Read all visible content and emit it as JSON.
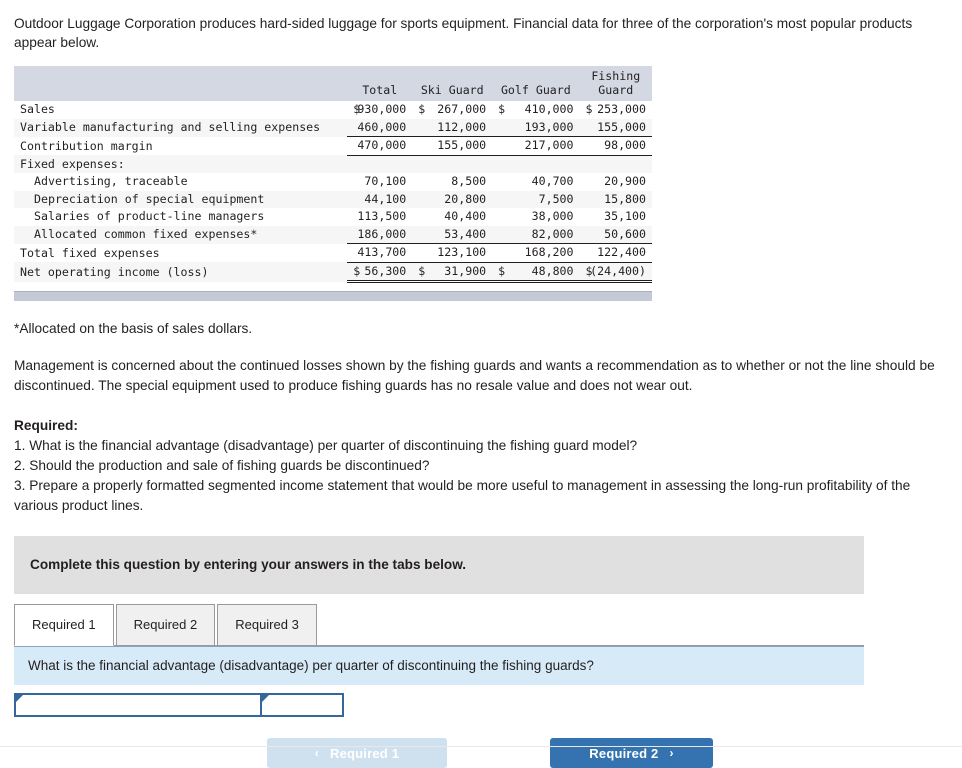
{
  "intro": {
    "text": "Outdoor Luggage Corporation produces hard-sided luggage for sports equipment.  Financial data for three of the corporation's most popular products appear below."
  },
  "table": {
    "columns": [
      "",
      "Total",
      "Ski Guard",
      "Golf Guard",
      "Fishing\nGuard"
    ],
    "rows": [
      {
        "label": "Sales",
        "total": "930,000",
        "ski": "267,000",
        "golf": "410,000",
        "fishing": "253,000",
        "currency": true,
        "indent": 0,
        "rule": "none"
      },
      {
        "label": "Variable manufacturing and selling expenses",
        "total": "460,000",
        "ski": "112,000",
        "golf": "193,000",
        "fishing": "155,000",
        "currency": false,
        "indent": 0,
        "rule": "under"
      },
      {
        "label": "Contribution margin",
        "total": "470,000",
        "ski": "155,000",
        "golf": "217,000",
        "fishing": "98,000",
        "currency": false,
        "indent": 0,
        "rule": "under"
      },
      {
        "label": "Fixed expenses:",
        "total": "",
        "ski": "",
        "golf": "",
        "fishing": "",
        "currency": false,
        "indent": 0,
        "rule": "none"
      },
      {
        "label": "Advertising, traceable",
        "total": "70,100",
        "ski": "8,500",
        "golf": "40,700",
        "fishing": "20,900",
        "currency": false,
        "indent": 1,
        "rule": "none"
      },
      {
        "label": "Depreciation of special equipment",
        "total": "44,100",
        "ski": "20,800",
        "golf": "7,500",
        "fishing": "15,800",
        "currency": false,
        "indent": 1,
        "rule": "none"
      },
      {
        "label": "Salaries of product-line managers",
        "total": "113,500",
        "ski": "40,400",
        "golf": "38,000",
        "fishing": "35,100",
        "currency": false,
        "indent": 1,
        "rule": "none"
      },
      {
        "label": "Allocated common fixed expenses*",
        "total": "186,000",
        "ski": "53,400",
        "golf": "82,000",
        "fishing": "50,600",
        "currency": false,
        "indent": 1,
        "rule": "under"
      },
      {
        "label": "Total fixed expenses",
        "total": "413,700",
        "ski": "123,100",
        "golf": "168,200",
        "fishing": "122,400",
        "currency": false,
        "indent": 0,
        "rule": "under"
      },
      {
        "label": "Net operating income (loss)",
        "total": "56,300",
        "ski": "31,900",
        "golf": "48,800",
        "fishing": "(24,400)",
        "currency": true,
        "indent": 0,
        "rule": "double"
      }
    ],
    "currency_symbol": "$"
  },
  "footnote": {
    "text": "*Allocated on the basis of sales dollars."
  },
  "management_para": {
    "text": "Management is concerned about the continued losses shown by the fishing guards and wants a recommendation as to whether or not the line should be discontinued. The special equipment used to produce fishing guards has no resale value and does not wear out."
  },
  "required": {
    "heading": "Required:",
    "items": [
      "1. What is the financial advantage (disadvantage) per quarter of discontinuing the fishing guard model?",
      "2. Should the production and sale of fishing guards be discontinued?",
      "3. Prepare a properly formatted segmented income statement that would be more useful to management in assessing the long-run profitability of the various product lines."
    ]
  },
  "instruction": {
    "text": "Complete this question by entering your answers in the tabs below."
  },
  "tabs": [
    {
      "label": "Required 1",
      "active": true
    },
    {
      "label": "Required 2",
      "active": false
    },
    {
      "label": "Required 3",
      "active": false
    }
  ],
  "question_band": {
    "text": "What is the financial advantage (disadvantage) per quarter of discontinuing the fishing guards?"
  },
  "answer_cells": [
    {
      "value": "",
      "name": "answer-label-cell"
    },
    {
      "value": "",
      "name": "answer-value-cell"
    }
  ],
  "nav": {
    "prev_label": "Required 1",
    "prev_chevron": "‹",
    "next_label": "Required 2",
    "next_chevron": "›"
  },
  "colors": {
    "table_header_bg": "#d3dae2",
    "instruction_bg": "#e0e0e0",
    "question_band_bg": "#d7eaf8",
    "accent_blue": "#3573b0",
    "cell_border_blue": "#35679f",
    "prev_button_bg": "#cfe0ef"
  }
}
